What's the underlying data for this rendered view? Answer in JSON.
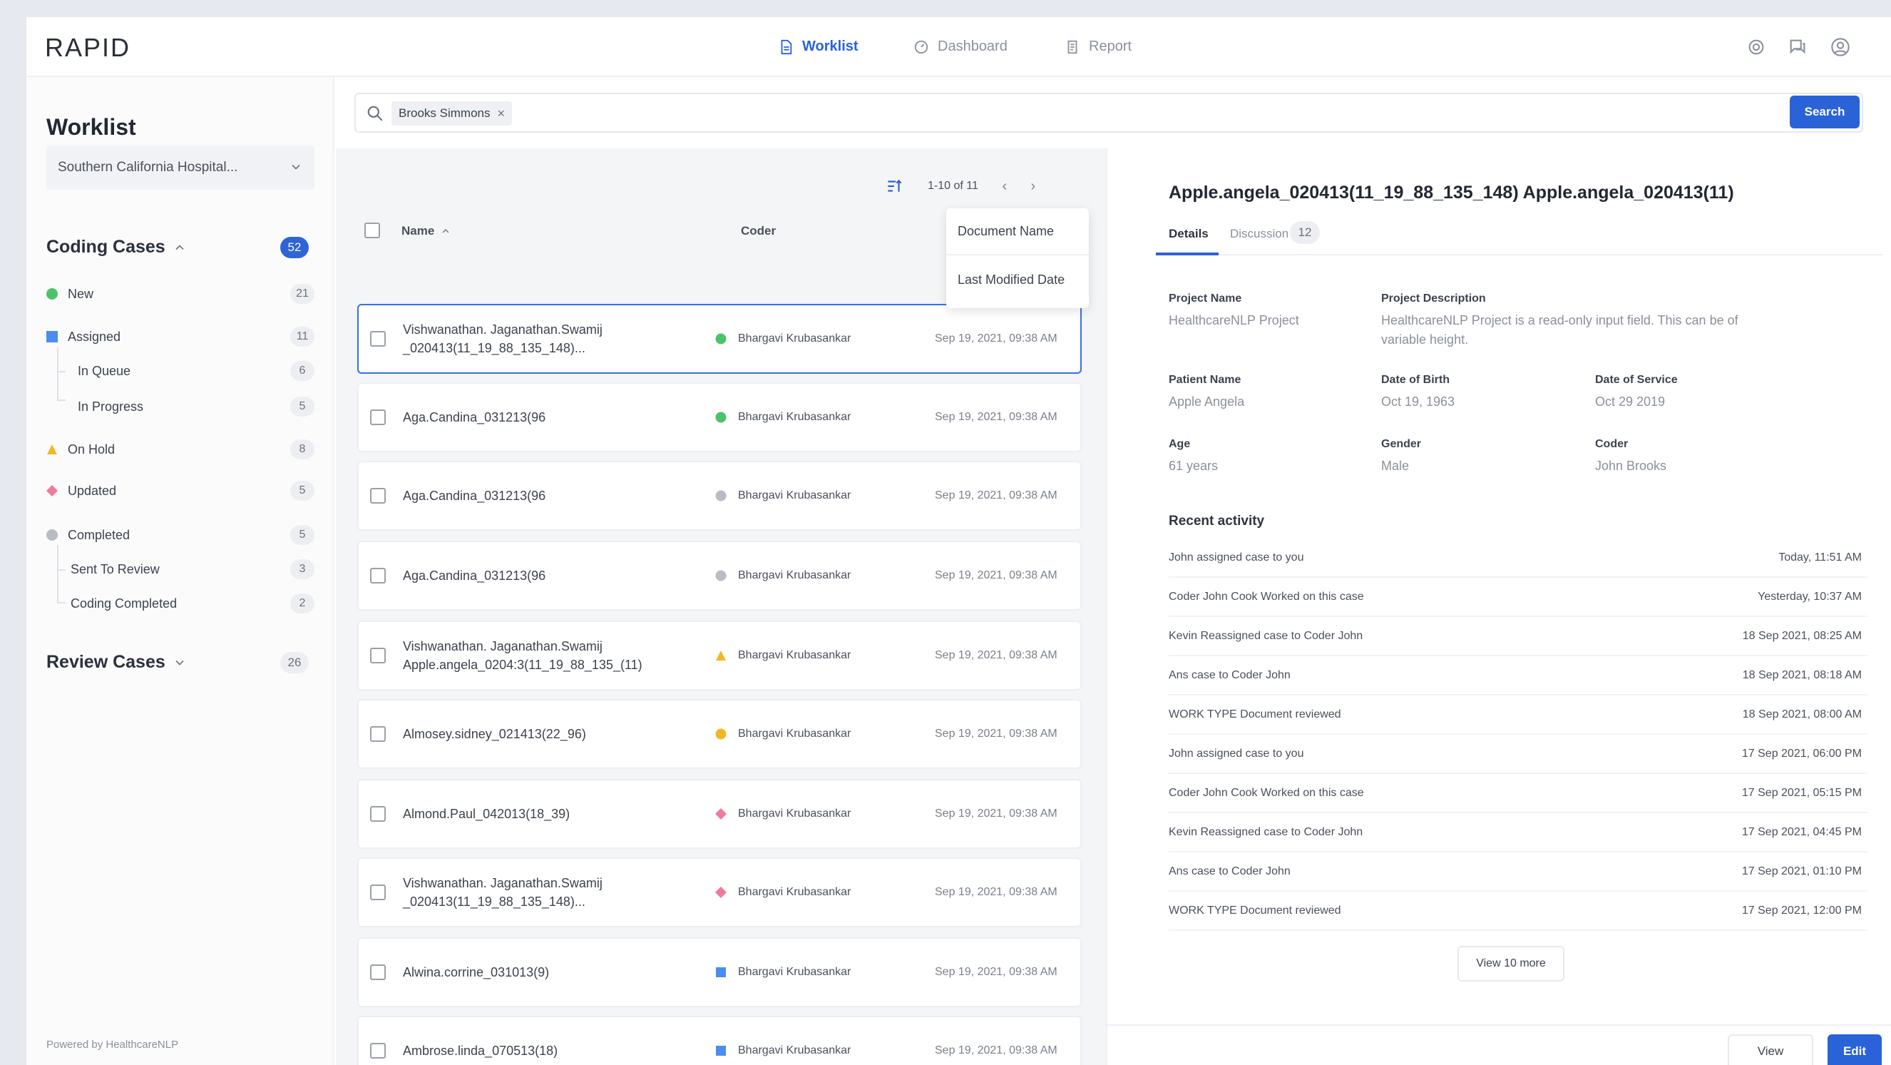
{
  "app": {
    "logo": "RAPID"
  },
  "nav": {
    "worklist": "Worklist",
    "dashboard": "Dashboard",
    "report": "Report"
  },
  "sidebar": {
    "title": "Worklist",
    "hospital": "Southern California Hospital...",
    "coding_cases": {
      "label": "Coding Cases",
      "count": "52"
    },
    "items": [
      {
        "label": "New",
        "count": "21",
        "color": "#4cc36a"
      },
      {
        "label": "Assigned",
        "count": "11",
        "color": "#4a8df0"
      },
      {
        "label": "In Queue",
        "count": "6"
      },
      {
        "label": "In Progress",
        "count": "5"
      },
      {
        "label": "On Hold",
        "count": "8",
        "color": "#f2b824"
      },
      {
        "label": "Updated",
        "count": "5",
        "color": "#f07a9a"
      },
      {
        "label": "Completed",
        "count": "5",
        "color": "#b8bcc4"
      },
      {
        "label": "Sent To Review",
        "count": "3"
      },
      {
        "label": "Coding Completed",
        "count": "2"
      }
    ],
    "review_cases": {
      "label": "Review Cases",
      "count": "26"
    },
    "powered_by": "Powered by HealthcareNLP"
  },
  "search": {
    "chip": "Brooks Simmons",
    "button": "Search"
  },
  "list": {
    "pager": "1-10 of 11",
    "headers": {
      "name": "Name",
      "coder": "Coder"
    },
    "sort_options": [
      "Document Name",
      "Last Modified Date"
    ],
    "rows": [
      {
        "name1": "Vishwanathan. Jaganathan.Swamij",
        "name2": "_020413(11_19_88_135_148)...",
        "coder": "Bhargavi Krubasankar",
        "date": "Sep 19, 2021, 09:38 AM",
        "status_color": "#4cc36a",
        "shape": "circle"
      },
      {
        "name1": "Aga.Candina_031213(96",
        "name2": "",
        "coder": "Bhargavi Krubasankar",
        "date": "Sep 19, 2021, 09:38 AM",
        "status_color": "#4cc36a",
        "shape": "circle"
      },
      {
        "name1": "Aga.Candina_031213(96",
        "name2": "",
        "coder": "Bhargavi Krubasankar",
        "date": "Sep 19, 2021, 09:38 AM",
        "status_color": "#b8bcc4",
        "shape": "circle"
      },
      {
        "name1": "Aga.Candina_031213(96",
        "name2": "",
        "coder": "Bhargavi Krubasankar",
        "date": "Sep 19, 2021, 09:38 AM",
        "status_color": "#b8bcc4",
        "shape": "circle"
      },
      {
        "name1": "Vishwanathan. Jaganathan.Swamij",
        "name2": "Apple.angela_0204:3(11_19_88_135_(11)",
        "coder": "Bhargavi Krubasankar",
        "date": "Sep 19, 2021, 09:38 AM",
        "status_color": "#f2b824",
        "shape": "triangle"
      },
      {
        "name1": "Almosey.sidney_021413(22_96)",
        "name2": "",
        "coder": "Bhargavi Krubasankar",
        "date": "Sep 19, 2021, 09:38 AM",
        "status_color": "#f2b824",
        "shape": "circle"
      },
      {
        "name1": "Almond.Paul_042013(18_39)",
        "name2": "",
        "coder": "Bhargavi Krubasankar",
        "date": "Sep 19, 2021, 09:38 AM",
        "status_color": "#f07a9a",
        "shape": "diamond"
      },
      {
        "name1": "Vishwanathan. Jaganathan.Swamij",
        "name2": "_020413(11_19_88_135_148)...",
        "coder": "Bhargavi Krubasankar",
        "date": "Sep 19, 2021, 09:38 AM",
        "status_color": "#f07a9a",
        "shape": "diamond"
      },
      {
        "name1": "Alwina.corrine_031013(9)",
        "name2": "",
        "coder": "Bhargavi Krubasankar",
        "date": "Sep 19, 2021, 09:38 AM",
        "status_color": "#4a8df0",
        "shape": "square"
      },
      {
        "name1": "Ambrose.linda_070513(18)",
        "name2": "",
        "coder": "Bhargavi Krubasankar",
        "date": "Sep 19, 2021, 09:38 AM",
        "status_color": "#4a8df0",
        "shape": "square"
      }
    ]
  },
  "detail": {
    "title": "Apple.angela_020413(11_19_88_135_148) Apple.angela_020413(11)",
    "tabs": {
      "details": "Details",
      "discussion": "Discussion",
      "discussion_count": "12"
    },
    "project_name_label": "Project Name",
    "project_name": "HealthcareNLP Project",
    "project_desc_label": "Project Description",
    "project_desc": "HealthcareNLP Project is a read-only input field. This can be of variable height.",
    "patient_name_label": "Patient Name",
    "patient_name": "Apple Angela",
    "dob_label": "Date of Birth",
    "dob": "Oct 19, 1963",
    "dos_label": "Date of Service",
    "dos": "Oct 29 2019",
    "age_label": "Age",
    "age": "61 years",
    "gender_label": "Gender",
    "gender": "Male",
    "coder_label": "Coder",
    "coder": "John Brooks",
    "recent_activity_label": "Recent activity",
    "activities": [
      {
        "text": "John assigned case to you",
        "time": "Today, 11:51 AM"
      },
      {
        "text": "Coder John Cook Worked on this case",
        "time": "Yesterday, 10:37 AM"
      },
      {
        "text": "Kevin Reassigned case to Coder John",
        "time": "18 Sep 2021, 08:25 AM"
      },
      {
        "text": "Ans case to Coder John",
        "time": "18 Sep 2021, 08:18 AM"
      },
      {
        "text": "WORK TYPE Document reviewed",
        "time": "18 Sep 2021, 08:00 AM"
      },
      {
        "text": "John assigned case to you",
        "time": "17 Sep 2021, 06:00 PM"
      },
      {
        "text": "Coder John Cook Worked on this case",
        "time": "17 Sep 2021, 05:15 PM"
      },
      {
        "text": "Kevin Reassigned case to Coder John",
        "time": "17 Sep 2021, 04:45 PM"
      },
      {
        "text": "Ans case to Coder John",
        "time": "17 Sep 2021, 01:10 PM"
      },
      {
        "text": "WORK TYPE Document reviewed",
        "time": "17 Sep 2021, 12:00 PM"
      }
    ],
    "view_more": "View 10 more",
    "view_button": "View",
    "edit_button": "Edit"
  }
}
